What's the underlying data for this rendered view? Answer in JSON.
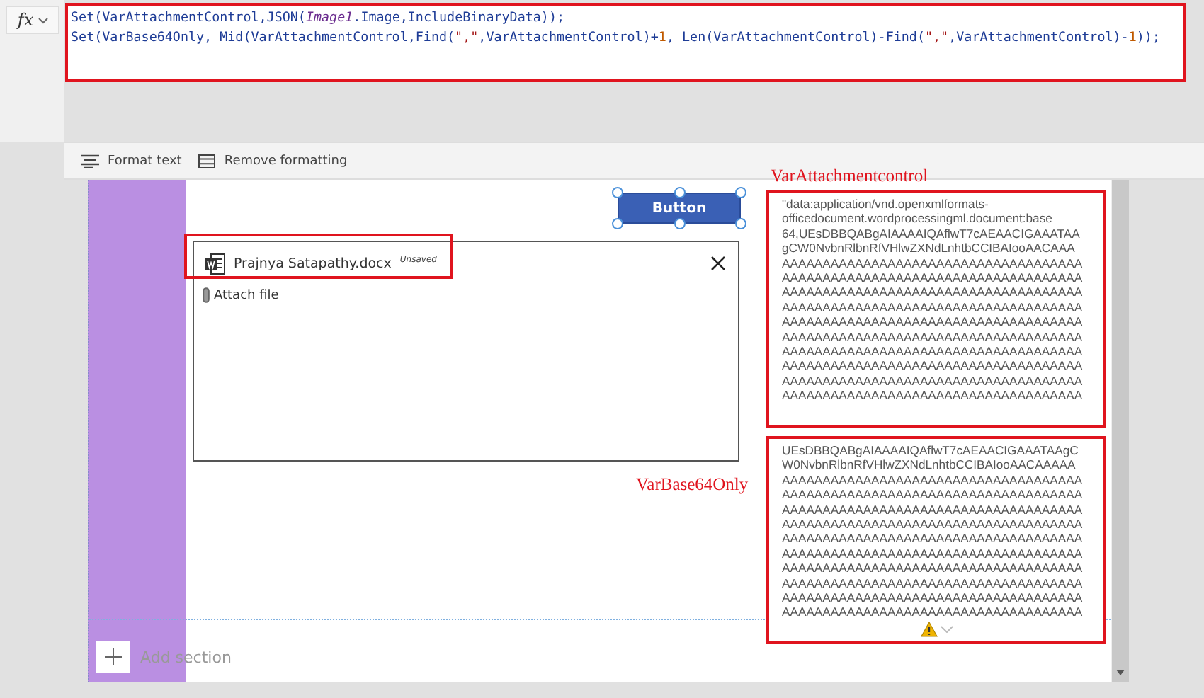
{
  "formula_bar": {
    "fx_label": "fx",
    "lines": [
      [
        {
          "text": "Set(VarAttachmentControl,JSON(",
          "kind": "code"
        },
        {
          "text": "Image1",
          "kind": "control"
        },
        {
          "text": ".Image,IncludeBinaryData));",
          "kind": "code"
        }
      ],
      [
        {
          "text": "Set(VarBase64Only, Mid(VarAttachmentControl,Find(",
          "kind": "code"
        },
        {
          "text": "\",\"",
          "kind": "string"
        },
        {
          "text": ",VarAttachmentControl)+",
          "kind": "code"
        },
        {
          "text": "1",
          "kind": "number"
        },
        {
          "text": ", Len(VarAttachmentControl)-Find(",
          "kind": "code"
        },
        {
          "text": "\",\"",
          "kind": "string"
        },
        {
          "text": ",VarAttachmentControl)-",
          "kind": "code"
        },
        {
          "text": "1",
          "kind": "number"
        },
        {
          "text": "));",
          "kind": "code"
        }
      ]
    ]
  },
  "toolbar": [
    {
      "label": "Format text",
      "kind": "format"
    },
    {
      "label": "Remove formatting",
      "kind": "clear"
    }
  ],
  "canvas": {
    "button": {
      "label": "Button",
      "selected": true
    },
    "attachment": {
      "file_name": "Prajnya Satapathy.docx",
      "status": "Unsaved",
      "attach_label": "Attach file"
    },
    "label_1": "VarAttachmentcontrol",
    "label_2": "VarBase64Only",
    "text_box_1": [
      "\"data:application/vnd.openxmlformats-",
      "officedocument.wordprocessingml.document:base",
      "64,UEsDBBQABgAIAAAAIQAflwT7cAEAACIGAAATAA",
      "gCW0NvbnRlbnRfVHlwZXNdLnhtbCCIBAIooAACAAA",
      "AAAAAAAAAAAAAAAAAAAAAAAAAAAAAAAAAAAAA",
      "AAAAAAAAAAAAAAAAAAAAAAAAAAAAAAAAAAAAA",
      "AAAAAAAAAAAAAAAAAAAAAAAAAAAAAAAAAAAAA",
      "AAAAAAAAAAAAAAAAAAAAAAAAAAAAAAAAAAAAA",
      "AAAAAAAAAAAAAAAAAAAAAAAAAAAAAAAAAAAAA",
      "AAAAAAAAAAAAAAAAAAAAAAAAAAAAAAAAAAAAA",
      "AAAAAAAAAAAAAAAAAAAAAAAAAAAAAAAAAAAAA",
      "AAAAAAAAAAAAAAAAAAAAAAAAAAAAAAAAAAAAA",
      "AAAAAAAAAAAAAAAAAAAAAAAAAAAAAAAAAAAAA",
      "AAAAAAAAAAAAAAAAAAAAAAAAAAAAAAAAAAAAA"
    ],
    "text_box_2": [
      "UEsDBBQABgAIAAAAIQAflwT7cAEAACIGAAATAAgC",
      "W0NvbnRlbnRfVHlwZXNdLnhtbCCIBAIooAACAAAAA",
      "AAAAAAAAAAAAAAAAAAAAAAAAAAAAAAAAAAAAA",
      "AAAAAAAAAAAAAAAAAAAAAAAAAAAAAAAAAAAAA",
      "AAAAAAAAAAAAAAAAAAAAAAAAAAAAAAAAAAAAA",
      "AAAAAAAAAAAAAAAAAAAAAAAAAAAAAAAAAAAAA",
      "AAAAAAAAAAAAAAAAAAAAAAAAAAAAAAAAAAAAA",
      "AAAAAAAAAAAAAAAAAAAAAAAAAAAAAAAAAAAAA",
      "AAAAAAAAAAAAAAAAAAAAAAAAAAAAAAAAAAAAA",
      "AAAAAAAAAAAAAAAAAAAAAAAAAAAAAAAAAAAAA",
      "AAAAAAAAAAAAAAAAAAAAAAAAAAAAAAAAAAAAA",
      "AAAAAAAAAAAAAAAAAAAAAAAAAAAAAAAAAAAAA"
    ],
    "add_section": "Add section"
  }
}
